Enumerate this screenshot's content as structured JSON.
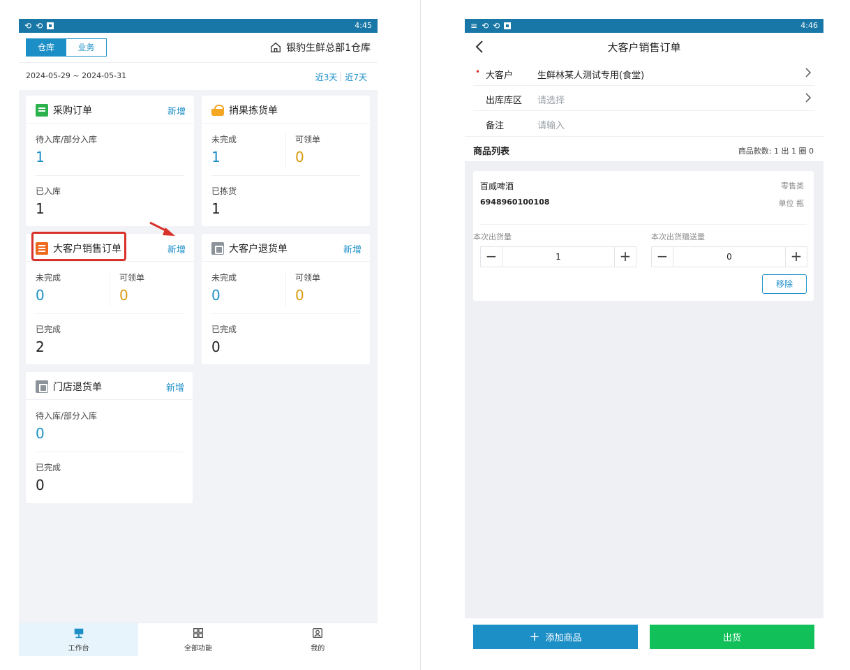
{
  "left": {
    "status": {
      "time": "4:45"
    },
    "segment": {
      "warehouse": "仓库",
      "business": "业务"
    },
    "warehouse_name": "银豹生鲜总部1仓库",
    "date_range": "2024-05-29 ~ 2024-05-31",
    "quick": {
      "three_days": "近3天",
      "seven_days": "近7天"
    },
    "add_label": "新增",
    "cards": {
      "purchase": {
        "title": "采购订单",
        "label1": "待入库/部分入库",
        "value1": "1",
        "label2": "已入库",
        "value2": "1"
      },
      "picking": {
        "title": "捎果拣货单",
        "label1": "未完成",
        "value1": "1",
        "label1b": "可领单",
        "value1b": "0",
        "label2": "已拣货",
        "value2": "1"
      },
      "sales": {
        "title": "大客户销售订单",
        "label1": "未完成",
        "value1": "0",
        "label1b": "可领单",
        "value1b": "0",
        "label2": "已完成",
        "value2": "2"
      },
      "return_big": {
        "title": "大客户退货单",
        "label1": "未完成",
        "value1": "0",
        "label1b": "可领单",
        "value1b": "0",
        "label2": "已完成",
        "value2": "0"
      },
      "return_store": {
        "title": "门店退货单",
        "label1": "待入库/部分入库",
        "value1": "0",
        "label2": "已完成",
        "value2": "0"
      }
    },
    "tabs": {
      "workbench": "工作台",
      "all": "全部功能",
      "mine": "我的"
    }
  },
  "right": {
    "status": {
      "time": "4:46"
    },
    "title": "大客户销售订单",
    "form": {
      "customer_label": "大客户",
      "customer_value": "生鲜林某人测试专用(食堂)",
      "area_label": "出库库区",
      "area_placeholder": "请选择",
      "remark_label": "备注",
      "remark_placeholder": "请输入"
    },
    "list": {
      "title": "商品列表",
      "count": "商品款数: 1  出 1 圈 0"
    },
    "product": {
      "name": "百威啤酒",
      "tag": "零售类",
      "code": "6948960100108",
      "unit": "单位 瓶",
      "qty_label": "本次出货量",
      "qty_value": "1",
      "gift_label": "本次出货赠送量",
      "gift_value": "0",
      "remove": "移除"
    },
    "buttons": {
      "add": "添加商品",
      "ship": "出货"
    }
  },
  "colors": {
    "primary": "#1d8fc7",
    "statusbar": "#1877a6",
    "ship": "#12c05a",
    "highlight": "#d8312a",
    "orange_number": "#d99c12"
  }
}
